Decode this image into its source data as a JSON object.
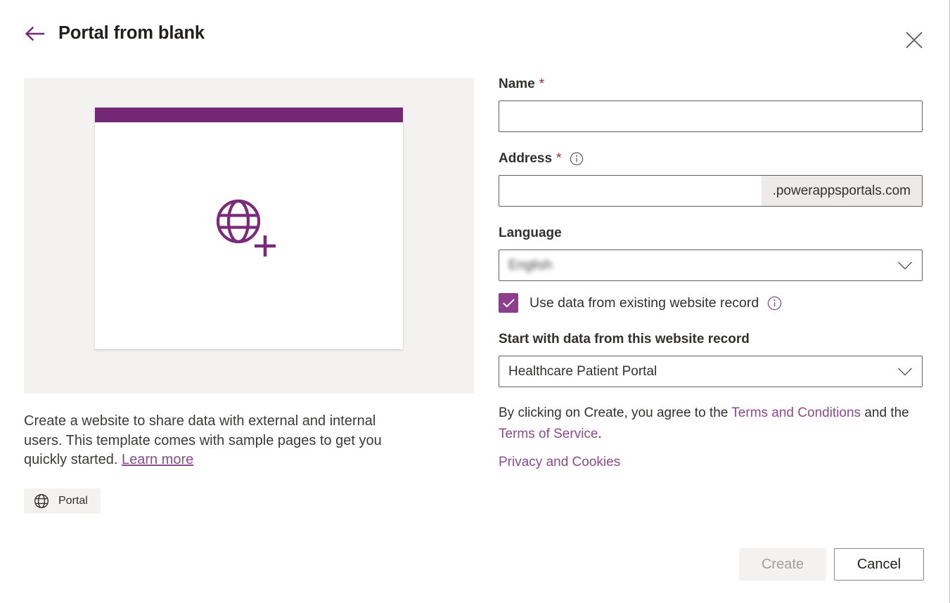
{
  "header": {
    "title": "Portal from blank",
    "back_icon": "arrow-left-icon",
    "close_icon": "close-icon"
  },
  "preview": {
    "icon": "globe-plus-icon",
    "bar_color": "#742774",
    "panel_color": "#f3f2f1"
  },
  "left": {
    "description_part1": "Create a website to share data with external and internal users. This template comes with sample pages to get you quickly started. ",
    "learn_more": "Learn more",
    "tag": {
      "icon": "globe-icon",
      "label": "Portal"
    }
  },
  "form": {
    "name": {
      "label": "Name",
      "required_marker": "*",
      "value": "",
      "placeholder": ""
    },
    "address": {
      "label": "Address",
      "required_marker": "*",
      "info_icon": "info-icon",
      "value": "",
      "placeholder": "",
      "suffix": ".powerappsportals.com"
    },
    "language": {
      "label": "Language",
      "value": "English",
      "redacted": true,
      "chevron_icon": "chevron-down-icon"
    },
    "use_existing": {
      "label": "Use data from existing website record",
      "checked": true,
      "check_icon": "checkmark-icon",
      "info_icon": "info-icon",
      "accent": "#8c3f8c"
    },
    "website_record": {
      "label": "Start with data from this website record",
      "value": "Healthcare Patient Portal",
      "chevron_icon": "chevron-down-icon"
    }
  },
  "legal": {
    "prefix": "By clicking on Create, you agree to the ",
    "terms_and_conditions": "Terms and Conditions",
    "middle": " and the ",
    "terms_of_service": "Terms of Service",
    "suffix": ".",
    "privacy": "Privacy and Cookies"
  },
  "footer": {
    "create_label": "Create",
    "create_disabled": true,
    "cancel_label": "Cancel"
  },
  "colors": {
    "brand_purple": "#742774",
    "link_purple": "#8c4a8f",
    "required_red": "#a4262c",
    "panel_gray": "#f3f2f1"
  }
}
